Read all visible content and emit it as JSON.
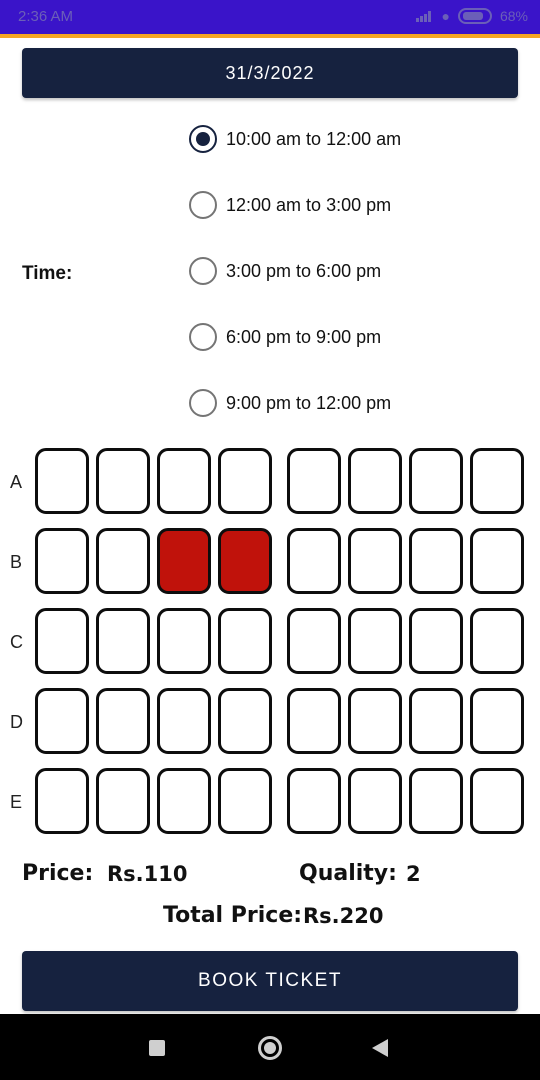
{
  "status_bar": {
    "time": "2:36 AM",
    "battery": "68%",
    "icons": [
      "signal-icon",
      "wifi-icon",
      "battery-icon"
    ]
  },
  "date": "31/3/2022",
  "time_section": {
    "label": "Time:",
    "selected_index": 0,
    "options": [
      "10:00 am to 12:00 am",
      "12:00 am to 3:00 pm",
      "3:00 pm to 6:00 pm",
      "6:00 pm to 9:00 pm",
      "9:00 pm to 12:00 pm"
    ]
  },
  "seats": {
    "rows": [
      "A",
      "B",
      "C",
      "D",
      "E"
    ],
    "columns": 8,
    "selected": [
      [
        "B",
        3
      ],
      [
        "B",
        4
      ]
    ]
  },
  "summary": {
    "price_label": "Price:",
    "price_value": "Rs.110",
    "quantity_label": "Quality:",
    "quantity_value": "2",
    "total_label": "Total Price:",
    "total_value": "Rs.220"
  },
  "book_button": "BOOK TICKET",
  "colors": {
    "status_bar": "#3a14c9",
    "accent": "#f5a623",
    "primary": "#16223f",
    "selected_seat": "#c0120b"
  },
  "nav_icons": [
    "recents-icon",
    "home-icon",
    "back-icon"
  ]
}
